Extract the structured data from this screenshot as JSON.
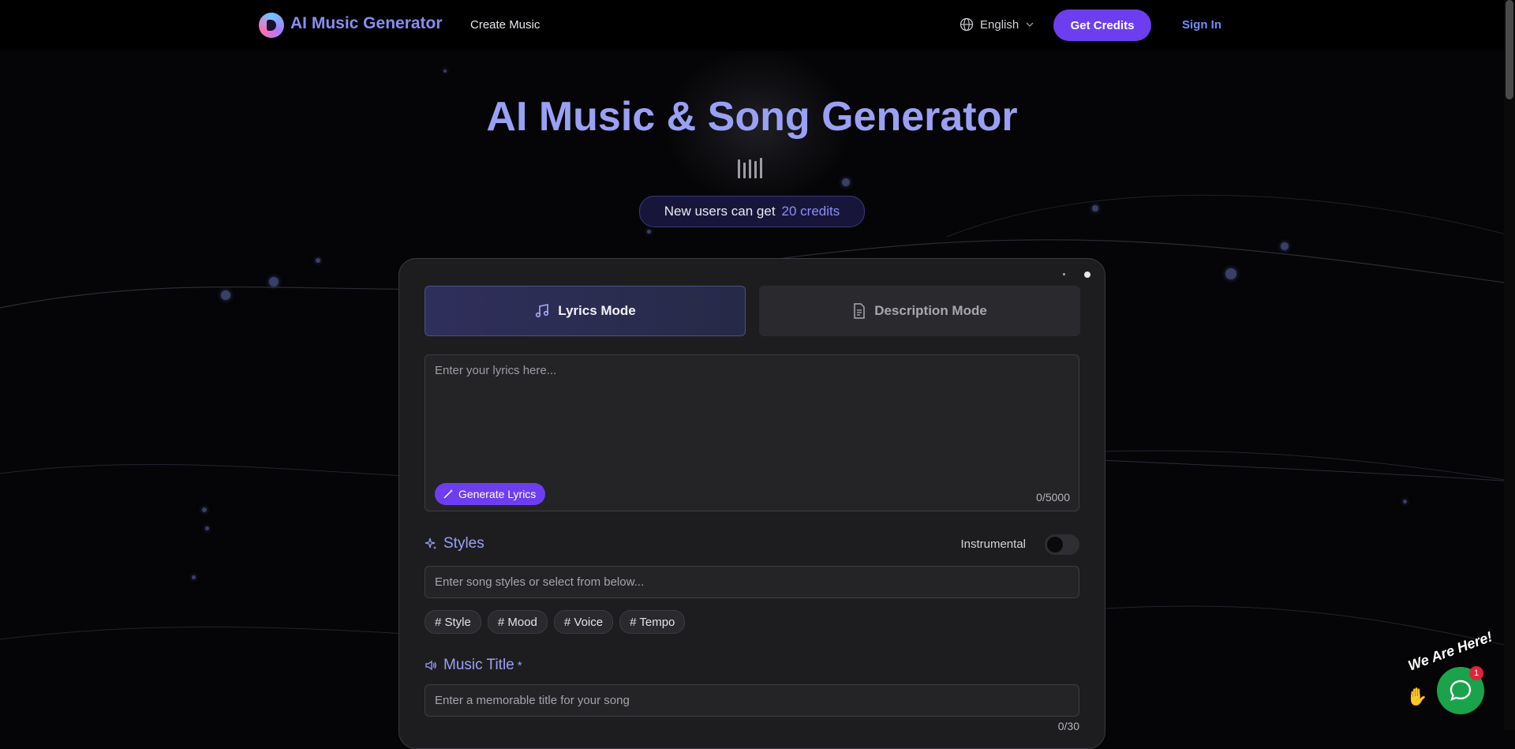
{
  "header": {
    "brand": "AI Music Generator",
    "nav_create": "Create Music",
    "language": "English",
    "get_credits": "Get Credits",
    "sign_in": "Sign In"
  },
  "hero": {
    "title": "AI Music & Song Generator",
    "badge_text": "New users can get",
    "badge_credits": "20 credits"
  },
  "modes": {
    "lyrics": "Lyrics Mode",
    "description": "Description Mode"
  },
  "lyrics": {
    "placeholder": "Enter your lyrics here...",
    "generate_button": "Generate Lyrics",
    "counter": "0/5000"
  },
  "styles": {
    "heading": "Styles",
    "instrumental_label": "Instrumental",
    "placeholder": "Enter song styles or select from below...",
    "chips": [
      "# Style",
      "# Mood",
      "# Voice",
      "# Tempo"
    ]
  },
  "music_title": {
    "heading": "Music Title",
    "required_mark": "*",
    "placeholder": "Enter a memorable title for your song",
    "counter": "0/30"
  },
  "chat_widget": {
    "sticker_text": "We Are Here!",
    "badge_count": "1"
  },
  "colors": {
    "accent": "#6d3ef0",
    "brand_text": "#8b8cf0",
    "chat_green": "#1aa34a"
  }
}
